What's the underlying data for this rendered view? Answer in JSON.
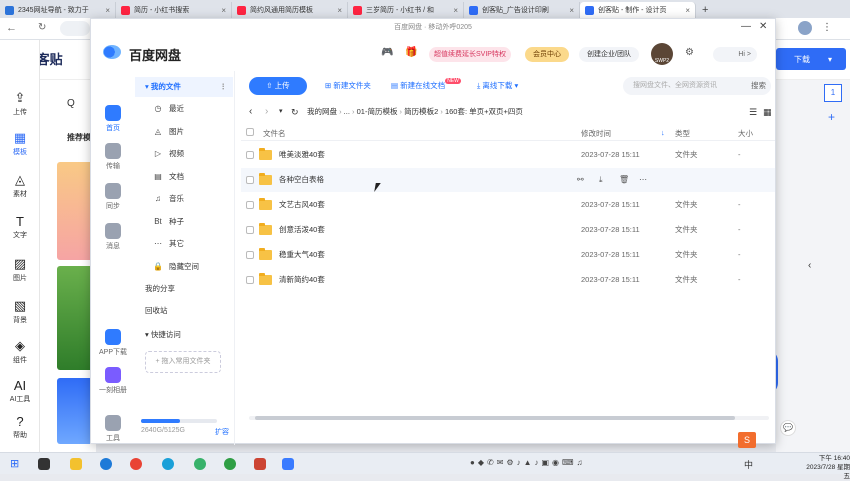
{
  "browser": {
    "tabs": [
      {
        "label": "2345网址导航 - 致力于",
        "color": "#2c73d9"
      },
      {
        "label": "简历 - 小红书搜索",
        "color": "#ff2442"
      },
      {
        "label": "简约风通用简历模板",
        "color": "#ff2442"
      },
      {
        "label": "三岁简历 - 小红书 / 和",
        "color": "#ff2442"
      },
      {
        "label": "创客贴_广告设计印刷",
        "color": "#2f6cf6"
      },
      {
        "label": "创客贴 - 制作 - 设计页",
        "color": "#2f6cf6",
        "active": true
      }
    ],
    "new_tab": "+",
    "window_min": "—",
    "window_close": "✕"
  },
  "site": {
    "logo": "创客贴",
    "download_btn": "下载",
    "search_placeholder": "Q",
    "recommend": "推荐模",
    "nav": [
      {
        "label": "上传",
        "icon": "cloud-upload-icon",
        "glyph": "⇪"
      },
      {
        "label": "模板",
        "icon": "template-icon",
        "glyph": "▦",
        "active": true
      },
      {
        "label": "素材",
        "icon": "shapes-icon",
        "glyph": "◬"
      },
      {
        "label": "文字",
        "icon": "text-icon",
        "glyph": "T"
      },
      {
        "label": "图片",
        "icon": "image-icon",
        "glyph": "▨"
      },
      {
        "label": "背景",
        "icon": "background-icon",
        "glyph": "▧"
      },
      {
        "label": "组件",
        "icon": "component-icon",
        "glyph": "◈"
      },
      {
        "label": "AI工具",
        "icon": "ai-icon",
        "glyph": "AI"
      },
      {
        "label": "帮助",
        "icon": "help-icon",
        "glyph": "?"
      }
    ],
    "page_number": "1",
    "add_page": "+"
  },
  "pan": {
    "title": "百度网盘 · 移动外呼0205",
    "logo_text": "百度网盘",
    "header": {
      "promo": "超值续费延长SVIP特权",
      "member_center": "会员中心",
      "enterprise": "创建企业/团队",
      "avatar_label": "SWP2",
      "hi": "Hi >"
    },
    "rail": [
      {
        "label": "首页",
        "icon": "home-cloud-icon",
        "active": true
      },
      {
        "label": "传输",
        "icon": "transfer-icon"
      },
      {
        "label": "同步",
        "icon": "sync-icon"
      },
      {
        "label": "消息",
        "icon": "message-icon"
      },
      {
        "label": "APP下载",
        "icon": "app-download-icon"
      },
      {
        "label": "一刻相册",
        "icon": "album-icon"
      },
      {
        "label": "工具",
        "icon": "tools-icon"
      }
    ],
    "nav": {
      "my_files": "▾ 我的文件",
      "items": [
        {
          "label": "最近",
          "glyph": "◷"
        },
        {
          "label": "图片",
          "glyph": "◬"
        },
        {
          "label": "视频",
          "glyph": "▷"
        },
        {
          "label": "文档",
          "glyph": "▤"
        },
        {
          "label": "音乐",
          "glyph": "♫"
        },
        {
          "label": "种子",
          "glyph": "Bt"
        },
        {
          "label": "其它",
          "glyph": "⋯"
        },
        {
          "label": "隐藏空间",
          "glyph": "🔒"
        }
      ],
      "my_share": "我的分享",
      "recycle": "回收站",
      "quick_access": "▾ 快捷访问",
      "add_common_folder": "+ 拖入常用文件夹",
      "storage": "2640G/5125G",
      "storage_fraction": 0.515,
      "expand": "扩容"
    },
    "toolbar": {
      "upload": "⇧ 上传",
      "new_folder": "新建文件夹",
      "new_online_doc": "新建在线文档",
      "new_badge": "NEW",
      "offline_download": "离线下载",
      "search_placeholder": "搜网盘文件、全网资源资讯",
      "search_btn": "搜索"
    },
    "breadcrumb": {
      "back": "‹",
      "forward": "›",
      "refresh": "↻",
      "path": [
        "我的网盘",
        "...",
        "01-简历模板",
        "简历模板2",
        "160套: 单页+双页+四页"
      ]
    },
    "table": {
      "headers": {
        "name": "文件名",
        "modified": "修改时间",
        "type": "类型",
        "size": "大小"
      },
      "rows": [
        {
          "name": "唯美淡雅40套",
          "modified": "2023-07-28 15:11",
          "type": "文件夹",
          "size": "-"
        },
        {
          "name": "各种空白表格",
          "modified": "",
          "type": "",
          "size": "",
          "hover": true
        },
        {
          "name": "文艺古风40套",
          "modified": "2023-07-28 15:11",
          "type": "文件夹",
          "size": "-"
        },
        {
          "name": "创意活泼40套",
          "modified": "2023-07-28 15:11",
          "type": "文件夹",
          "size": "-"
        },
        {
          "name": "稳重大气40套",
          "modified": "2023-07-28 15:11",
          "type": "文件夹",
          "size": "-"
        },
        {
          "name": "清新简约40套",
          "modified": "2023-07-28 15:11",
          "type": "文件夹",
          "size": "-"
        }
      ]
    }
  },
  "taskbar": {
    "time": "下午 16:40",
    "date": "2023/7/28 星期五",
    "ime": "中"
  }
}
